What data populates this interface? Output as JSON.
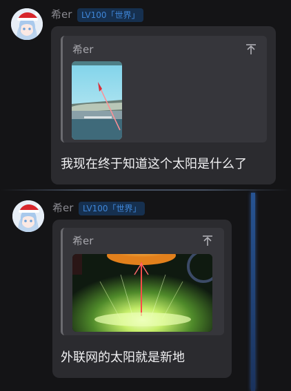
{
  "messages": [
    {
      "user": {
        "name": "希er",
        "badge": "LV100「世界」"
      },
      "quote": {
        "name": "希er",
        "up_icon": "arrow-up-to-top-icon",
        "image": "anime-screenshot-sky-beam"
      },
      "text": "我现在终于知道这个太阳是什么了"
    },
    {
      "user": {
        "name": "希er",
        "badge": "LV100「世界」"
      },
      "quote": {
        "name": "希er",
        "up_icon": "arrow-up-to-top-icon",
        "image": "anime-screenshot-green-explosion"
      },
      "text": "外联网的太阳就是新地"
    }
  ],
  "colors": {
    "background": "#141416",
    "bubble": "#2b2b2f",
    "quote": "#36363b",
    "badge_text": "#3f86d8",
    "badge_bg": "#16304f"
  }
}
